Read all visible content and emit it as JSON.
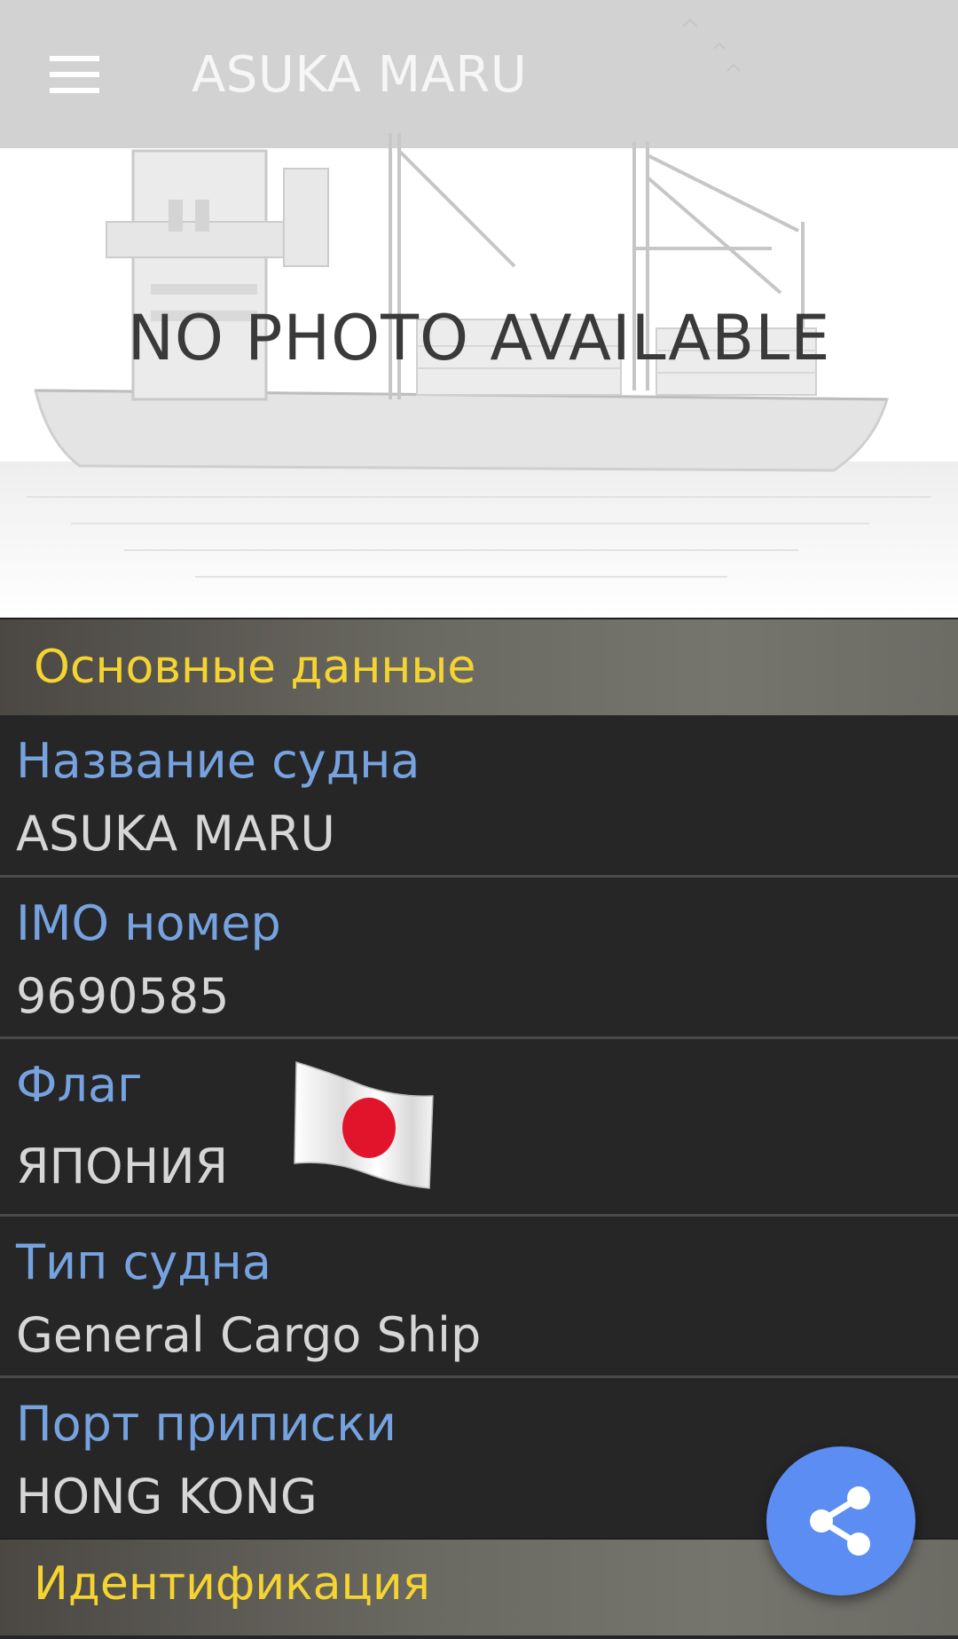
{
  "toolbar": {
    "title": "ASUKA MARU",
    "menu_icon": "hamburger-menu-icon"
  },
  "photo": {
    "placeholder_text": "NO PHOTO AVAILABLE"
  },
  "sections": {
    "main": {
      "title": "Основные данные",
      "rows": [
        {
          "label": "Название судна",
          "value": "ASUKA MARU"
        },
        {
          "label": "IMO номер",
          "value": "9690585"
        },
        {
          "label": "Флаг",
          "value": "ЯПОНИЯ",
          "icon": "japan-flag-icon"
        },
        {
          "label": "Тип судна",
          "value": "General Cargo Ship"
        },
        {
          "label": "Порт приписки",
          "value": "HONG KONG"
        }
      ]
    },
    "identification": {
      "title": "Идентификация"
    }
  },
  "fab": {
    "icon": "share-icon"
  },
  "colors": {
    "section_title": "#f5d431",
    "label": "#76a3e0",
    "value": "#d6d6d6",
    "fab": "#5b8df3",
    "background": "#262626"
  }
}
